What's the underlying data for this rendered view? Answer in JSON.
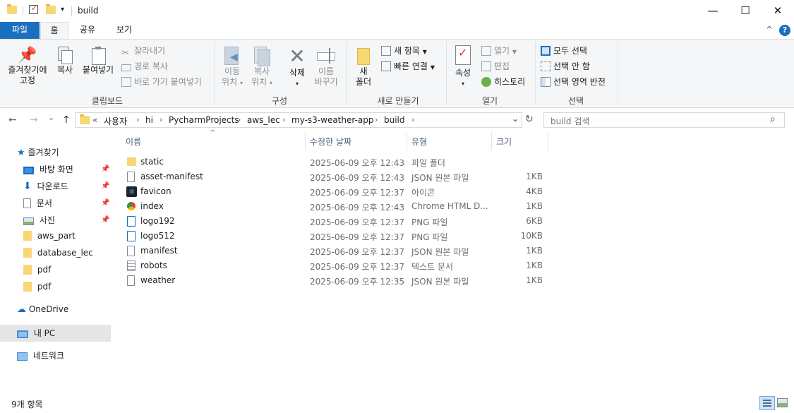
{
  "window": {
    "title": "build",
    "minimize": "—",
    "maximize": "☐",
    "close": "✕",
    "qa_dropdown": "▾"
  },
  "tabs": [
    "파일",
    "홈",
    "공유",
    "보기"
  ],
  "help_icon": "?",
  "collapse_icon": "^",
  "ribbon": {
    "clipboard": {
      "pin_label_1": "즐겨찾기에",
      "pin_label_2": "고정",
      "copy": "복사",
      "paste": "붙여넣기",
      "cut": "잘라내기",
      "copy_path": "경로 복사",
      "paste_shortcut": "바로 가기 붙여넣기",
      "group": "클립보드"
    },
    "organize": {
      "move_1": "이동",
      "move_2": "위치",
      "copy_1": "복사",
      "copy_2": "위치",
      "delete": "삭제",
      "rename_1": "이름",
      "rename_2": "바꾸기",
      "group": "구성"
    },
    "new": {
      "new_folder_1": "새",
      "new_folder_2": "폴더",
      "new_item": "새 항목",
      "easy_access": "빠른 연결",
      "group": "새로 만들기"
    },
    "open": {
      "properties": "속성",
      "open": "열기",
      "edit": "편집",
      "history": "히스토리",
      "group": "열기"
    },
    "select": {
      "select_all": "모두 선택",
      "select_none": "선택 안 함",
      "invert": "선택 영역 반전",
      "group": "선택"
    }
  },
  "nav": {
    "back": "←",
    "forward": "→",
    "recent": "⌄",
    "up": "↑",
    "crumbs": [
      "«",
      "사용자",
      "hi",
      "PycharmProjects",
      "aws_lec",
      "my-s3-weather-app",
      "build"
    ],
    "crumb_sep": "›",
    "dropdown": "⌄",
    "refresh": "↻",
    "search_placeholder": "build 검색",
    "search_icon": "⌕"
  },
  "sidebar": {
    "quick_access": "즐겨찾기",
    "items": [
      {
        "label": "바탕 화면",
        "pinned": true,
        "icon": "desktop-icon"
      },
      {
        "label": "다운로드",
        "pinned": true,
        "icon": "download-icon"
      },
      {
        "label": "문서",
        "pinned": true,
        "icon": "document-icon"
      },
      {
        "label": "사진",
        "pinned": true,
        "icon": "pictures-icon"
      },
      {
        "label": "aws_part",
        "pinned": false,
        "icon": "folder-icon"
      },
      {
        "label": "database_lec",
        "pinned": false,
        "icon": "folder-icon"
      },
      {
        "label": "pdf",
        "pinned": false,
        "icon": "folder-icon"
      },
      {
        "label": "pdf",
        "pinned": false,
        "icon": "folder-icon"
      }
    ],
    "onedrive": "OneDrive",
    "this_pc": "내 PC",
    "network": "네트워크",
    "pin_glyph": "📌"
  },
  "columns": {
    "name": "이름",
    "date": "수정한 날짜",
    "type": "유형",
    "size": "크기",
    "sort_indicator": "^"
  },
  "files": [
    {
      "name": "static",
      "date": "2025-06-09 오후 12:43",
      "type": "파일 폴더",
      "size": "",
      "icon": "folder-icon"
    },
    {
      "name": "asset-manifest",
      "date": "2025-06-09 오후 12:43",
      "type": "JSON 원본 파일",
      "size": "1KB",
      "icon": "json-file-icon"
    },
    {
      "name": "favicon",
      "date": "2025-06-09 오후 12:37",
      "type": "아이콘",
      "size": "4KB",
      "icon": "react-icon"
    },
    {
      "name": "index",
      "date": "2025-06-09 오후 12:43",
      "type": "Chrome HTML D...",
      "size": "1KB",
      "icon": "chrome-icon"
    },
    {
      "name": "logo192",
      "date": "2025-06-09 오후 12:37",
      "type": "PNG 파일",
      "size": "6KB",
      "icon": "png-file-icon"
    },
    {
      "name": "logo512",
      "date": "2025-06-09 오후 12:37",
      "type": "PNG 파일",
      "size": "10KB",
      "icon": "png-file-icon"
    },
    {
      "name": "manifest",
      "date": "2025-06-09 오후 12:37",
      "type": "JSON 원본 파일",
      "size": "1KB",
      "icon": "json-file-icon"
    },
    {
      "name": "robots",
      "date": "2025-06-09 오후 12:37",
      "type": "텍스트 문서",
      "size": "1KB",
      "icon": "text-file-icon"
    },
    {
      "name": "weather",
      "date": "2025-06-09 오후 12:35",
      "type": "JSON 원본 파일",
      "size": "1KB",
      "icon": "json-file-icon"
    }
  ],
  "status": {
    "count": "9개 항목"
  },
  "colors": {
    "file_tab": "#1a6fc0",
    "selected_nav": "#e5e5e5",
    "folder": "#f8d775"
  }
}
